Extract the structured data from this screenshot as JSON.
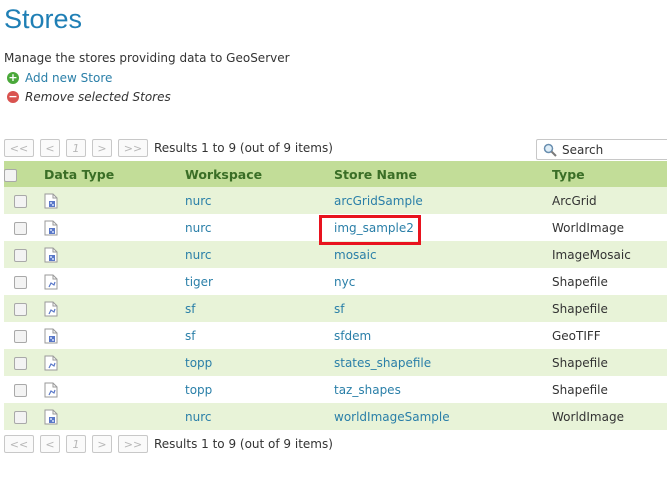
{
  "page": {
    "title": "Stores",
    "description": "Manage the stores providing data to GeoServer",
    "add_store_label": "Add new Store",
    "remove_stores_label": "Remove selected Stores"
  },
  "pager": {
    "first": "<<",
    "prev": "<",
    "page": "1",
    "next": ">",
    "last": ">>",
    "results": "Results 1 to 9 (out of 9 items)"
  },
  "search": {
    "placeholder": "Search"
  },
  "table": {
    "headers": [
      "Data Type",
      "Workspace",
      "Store Name",
      "Type"
    ],
    "rows": [
      {
        "icon": "raster-file-icon",
        "workspace": "nurc",
        "store": "arcGridSample",
        "type": "ArcGrid"
      },
      {
        "icon": "raster-file-icon",
        "workspace": "nurc",
        "store": "img_sample2",
        "type": "WorldImage"
      },
      {
        "icon": "raster-file-icon",
        "workspace": "nurc",
        "store": "mosaic",
        "type": "ImageMosaic"
      },
      {
        "icon": "vector-file-icon",
        "workspace": "tiger",
        "store": "nyc",
        "type": "Shapefile"
      },
      {
        "icon": "vector-file-icon",
        "workspace": "sf",
        "store": "sf",
        "type": "Shapefile"
      },
      {
        "icon": "raster-file-icon",
        "workspace": "sf",
        "store": "sfdem",
        "type": "GeoTIFF"
      },
      {
        "icon": "vector-file-icon",
        "workspace": "topp",
        "store": "states_shapefile",
        "type": "Shapefile"
      },
      {
        "icon": "vector-file-icon",
        "workspace": "topp",
        "store": "taz_shapes",
        "type": "Shapefile"
      },
      {
        "icon": "raster-file-icon",
        "workspace": "nurc",
        "store": "worldImageSample",
        "type": "WorldImage"
      }
    ]
  },
  "colors": {
    "title": "#1f7fb5",
    "link": "#2a7fa8",
    "header_bg": "#c2dd98",
    "header_text": "#3a6e26",
    "odd_row_bg": "#e8f3d8",
    "highlight": "#e8131e"
  }
}
